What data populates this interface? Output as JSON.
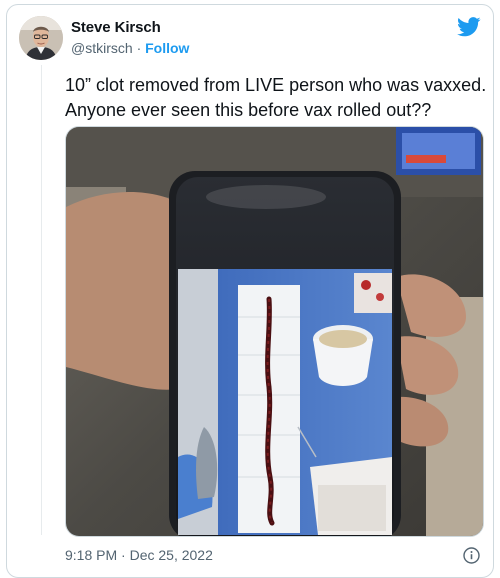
{
  "author": {
    "name": "Steve Kirsch",
    "handle": "@stkirsch",
    "separator": "·",
    "follow_label": "Follow"
  },
  "tweet": {
    "text": "10” clot removed from LIVE person who was vaxxed. Anyone ever seen this before vax rolled out??",
    "timestamp": "9:18 PM · Dec 25, 2022"
  },
  "icons": {
    "brand": "twitter-bird-icon",
    "info": "info-icon"
  },
  "colors": {
    "accent": "#1d9bf0",
    "muted_text": "#536471",
    "text": "#0f1419",
    "border": "#cfd9de"
  }
}
